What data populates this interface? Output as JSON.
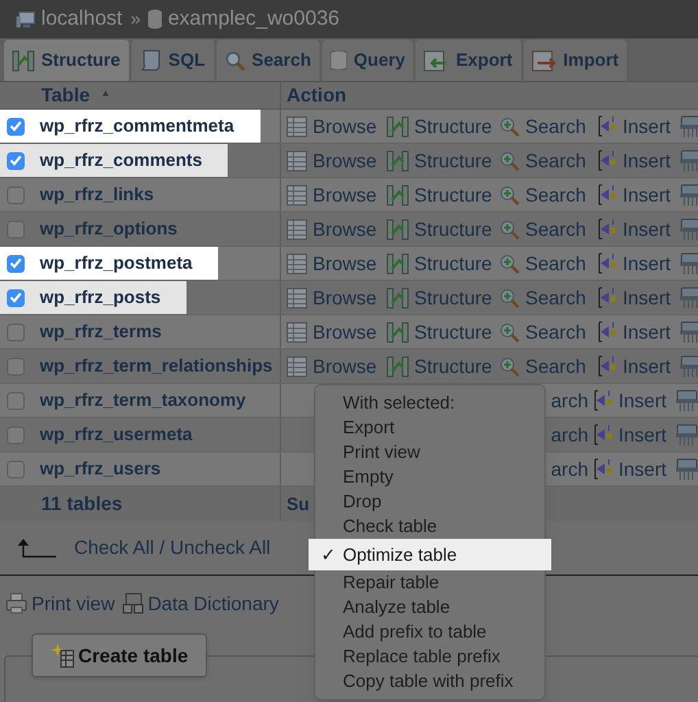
{
  "breadcrumb": {
    "items": [
      {
        "label": "localhost",
        "kind": "server"
      },
      {
        "label": "examplec_wo0036",
        "kind": "database"
      }
    ],
    "separator": "»"
  },
  "tabs": [
    {
      "label": "Structure",
      "kind": "structure",
      "selected": true
    },
    {
      "label": "SQL",
      "kind": "sql",
      "selected": false
    },
    {
      "label": "Search",
      "kind": "search",
      "selected": false
    },
    {
      "label": "Query",
      "kind": "query",
      "selected": false
    },
    {
      "label": "Export",
      "kind": "export",
      "selected": false
    },
    {
      "label": "Import",
      "kind": "import",
      "selected": false
    }
  ],
  "table": {
    "columns": [
      "Table",
      "Action"
    ],
    "sort_mark": "▲",
    "rows": [
      {
        "name": "wp_rfrz_commentmeta",
        "checked": true,
        "actions": [
          {
            "label": "Browse",
            "kind": "browse"
          },
          {
            "label": "Structure",
            "kind": "structure"
          },
          {
            "label": "Search",
            "kind": "search"
          },
          {
            "label": "Insert",
            "kind": "insert"
          },
          {
            "kind": "empty"
          }
        ]
      },
      {
        "name": "wp_rfrz_comments",
        "checked": true,
        "actions": [
          {
            "label": "Browse",
            "kind": "browse"
          },
          {
            "label": "Structure",
            "kind": "structure"
          },
          {
            "label": "Search",
            "kind": "search"
          },
          {
            "label": "Insert",
            "kind": "insert"
          },
          {
            "kind": "empty"
          }
        ]
      },
      {
        "name": "wp_rfrz_links",
        "checked": false,
        "actions": [
          {
            "label": "Browse",
            "kind": "browse"
          },
          {
            "label": "Structure",
            "kind": "structure"
          },
          {
            "label": "Search",
            "kind": "search"
          },
          {
            "label": "Insert",
            "kind": "insert"
          },
          {
            "kind": "empty"
          }
        ]
      },
      {
        "name": "wp_rfrz_options",
        "checked": false,
        "actions": [
          {
            "label": "Browse",
            "kind": "browse"
          },
          {
            "label": "Structure",
            "kind": "structure"
          },
          {
            "label": "Search",
            "kind": "search"
          },
          {
            "label": "Insert",
            "kind": "insert"
          },
          {
            "kind": "empty"
          }
        ]
      },
      {
        "name": "wp_rfrz_postmeta",
        "checked": true,
        "actions": [
          {
            "label": "Browse",
            "kind": "browse"
          },
          {
            "label": "Structure",
            "kind": "structure"
          },
          {
            "label": "Search",
            "kind": "search"
          },
          {
            "label": "Insert",
            "kind": "insert"
          },
          {
            "kind": "empty"
          }
        ]
      },
      {
        "name": "wp_rfrz_posts",
        "checked": true,
        "actions": [
          {
            "label": "Browse",
            "kind": "browse"
          },
          {
            "label": "Structure",
            "kind": "structure"
          },
          {
            "label": "Search",
            "kind": "search"
          },
          {
            "label": "Insert",
            "kind": "insert"
          },
          {
            "kind": "empty"
          }
        ]
      },
      {
        "name": "wp_rfrz_terms",
        "checked": false,
        "actions": [
          {
            "label": "Browse",
            "kind": "browse"
          },
          {
            "label": "Structure",
            "kind": "structure"
          },
          {
            "label": "Search",
            "kind": "search"
          },
          {
            "label": "Insert",
            "kind": "insert"
          },
          {
            "kind": "empty"
          }
        ]
      },
      {
        "name": "wp_rfrz_term_relationships",
        "checked": false,
        "actions": [
          {
            "label": "Browse",
            "kind": "browse"
          },
          {
            "label": "Structure",
            "kind": "structure"
          },
          {
            "label": "Search",
            "kind": "search"
          },
          {
            "label": "Insert",
            "kind": "insert"
          },
          {
            "kind": "empty"
          }
        ]
      },
      {
        "name": "wp_rfrz_term_taxonomy",
        "checked": false,
        "actions": [
          {
            "label": "arch",
            "kind": "search_cut"
          },
          {
            "label": "Insert",
            "kind": "insert"
          },
          {
            "kind": "empty"
          }
        ]
      },
      {
        "name": "wp_rfrz_usermeta",
        "checked": false,
        "actions": [
          {
            "label": "arch",
            "kind": "search_cut"
          },
          {
            "label": "Insert",
            "kind": "insert"
          },
          {
            "kind": "empty"
          }
        ]
      },
      {
        "name": "wp_rfrz_users",
        "checked": false,
        "actions": [
          {
            "label": "arch",
            "kind": "search_cut"
          },
          {
            "label": "Insert",
            "kind": "insert"
          },
          {
            "kind": "empty"
          }
        ]
      }
    ],
    "footer": {
      "label": "11 tables",
      "column_2": "Su"
    }
  },
  "check_all": "Check All / Uncheck All",
  "links": [
    {
      "label": "Print view",
      "kind": "print"
    },
    {
      "label": "Data Dictionary",
      "kind": "dictionary"
    }
  ],
  "create_button": "Create table",
  "menu": {
    "items": [
      {
        "label": "With selected:",
        "selected": false
      },
      {
        "label": "Export",
        "selected": false
      },
      {
        "label": "Print view",
        "selected": false
      },
      {
        "label": "Empty",
        "selected": false
      },
      {
        "label": "Drop",
        "selected": false
      },
      {
        "label": "Check table",
        "selected": false
      },
      {
        "label": "Optimize table",
        "selected": true
      },
      {
        "label": "Repair table",
        "selected": false
      },
      {
        "label": "Analyze table",
        "selected": false
      },
      {
        "label": "Add prefix to table",
        "selected": false
      },
      {
        "label": "Replace table prefix",
        "selected": false
      },
      {
        "label": "Copy table with prefix",
        "selected": false
      }
    ],
    "check": "✓"
  }
}
